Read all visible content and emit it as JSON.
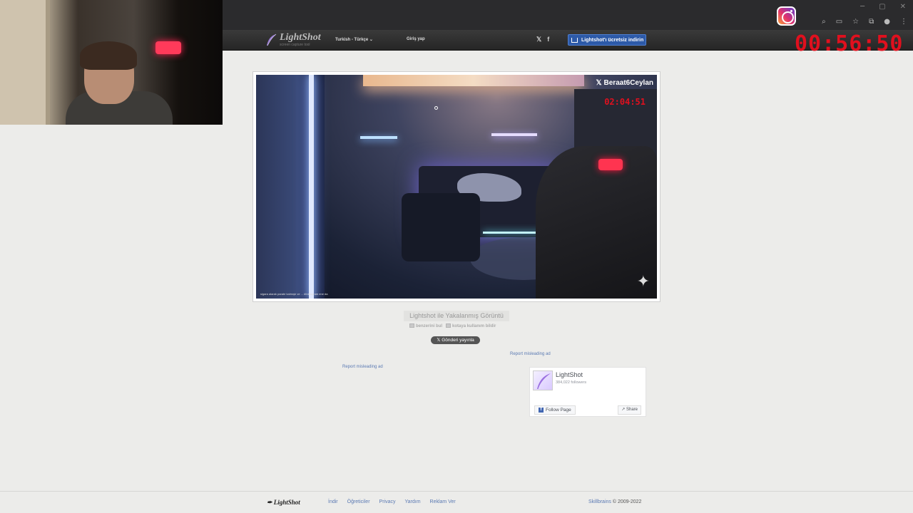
{
  "browser": {
    "window_controls": [
      "─",
      "▢",
      "✕"
    ],
    "toolbar_icons": [
      "⌕",
      "▭",
      "☆",
      "⧉",
      "●",
      "⋮"
    ]
  },
  "overlay": {
    "timer": "00:56:50"
  },
  "header": {
    "logo_name": "LightShot",
    "logo_sub": "screen capture tool",
    "language": "Turkish - Türkçe ⌄",
    "login": "Giriş yap",
    "social": [
      "𝕏",
      "f"
    ],
    "download_button": "Lightshot'ı ücretsiz indirin"
  },
  "screenshot": {
    "streamer_name": "Beraat6Ceylan",
    "x_icon": "𝕏",
    "stream_timer": "02:04:51",
    "caption": "sigara alarak parate kalmıştı ve ... #Instagram ene da",
    "sparkle": "✦"
  },
  "caption": {
    "title": "Lightshot ile Yakalanmış Görüntü",
    "links": [
      "benzerini bul",
      "kotaya kullanım bildir"
    ],
    "tweet_button": "Gönderi yayınla"
  },
  "ads": {
    "report_right": "Report misleading ad",
    "report_left": "Report misleading ad"
  },
  "facebook": {
    "page_name": "LightShot",
    "followers": "384,022 followers",
    "follow_button": "Follow Page",
    "share_button": "Share"
  },
  "footer": {
    "logo": "LightShot",
    "links": [
      "İndir",
      "Öğreticiler",
      "Privacy",
      "Yardım",
      "Reklam Ver"
    ],
    "brand": "Skillbrains",
    "copyright": " © 2009-2022"
  },
  "colors": {
    "timer_red": "#e0101e",
    "link_blue": "#5b7ab3",
    "download_blue": "#2d5aa8"
  }
}
